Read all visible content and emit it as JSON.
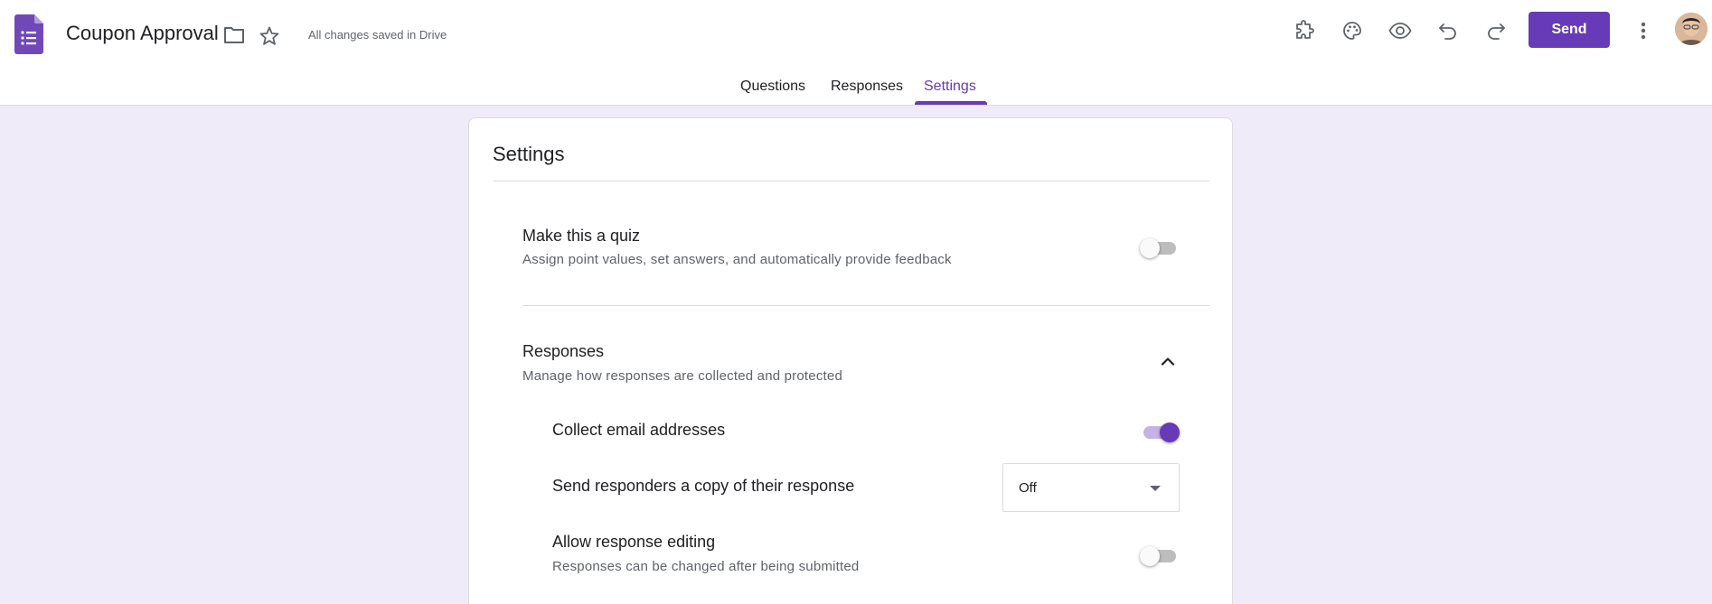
{
  "header": {
    "title": "Coupon Approval",
    "save_status": "All changes saved in Drive",
    "send_label": "Send",
    "accent_color": "#673ab7"
  },
  "tabs": [
    {
      "label": "Questions",
      "active": false
    },
    {
      "label": "Responses",
      "active": false
    },
    {
      "label": "Settings",
      "active": true
    }
  ],
  "settings": {
    "title": "Settings",
    "quiz": {
      "title": "Make this a quiz",
      "subtitle": "Assign point values, set answers, and automatically provide feedback",
      "enabled": false
    },
    "responses": {
      "title": "Responses",
      "subtitle": "Manage how responses are collected and protected",
      "expanded": true,
      "collect_email": {
        "title": "Collect email addresses",
        "enabled": true
      },
      "send_copy": {
        "title": "Send responders a copy of their response",
        "value": "Off"
      },
      "allow_editing": {
        "title": "Allow response editing",
        "subtitle": "Responses can be changed after being submitted",
        "enabled": false
      }
    }
  }
}
